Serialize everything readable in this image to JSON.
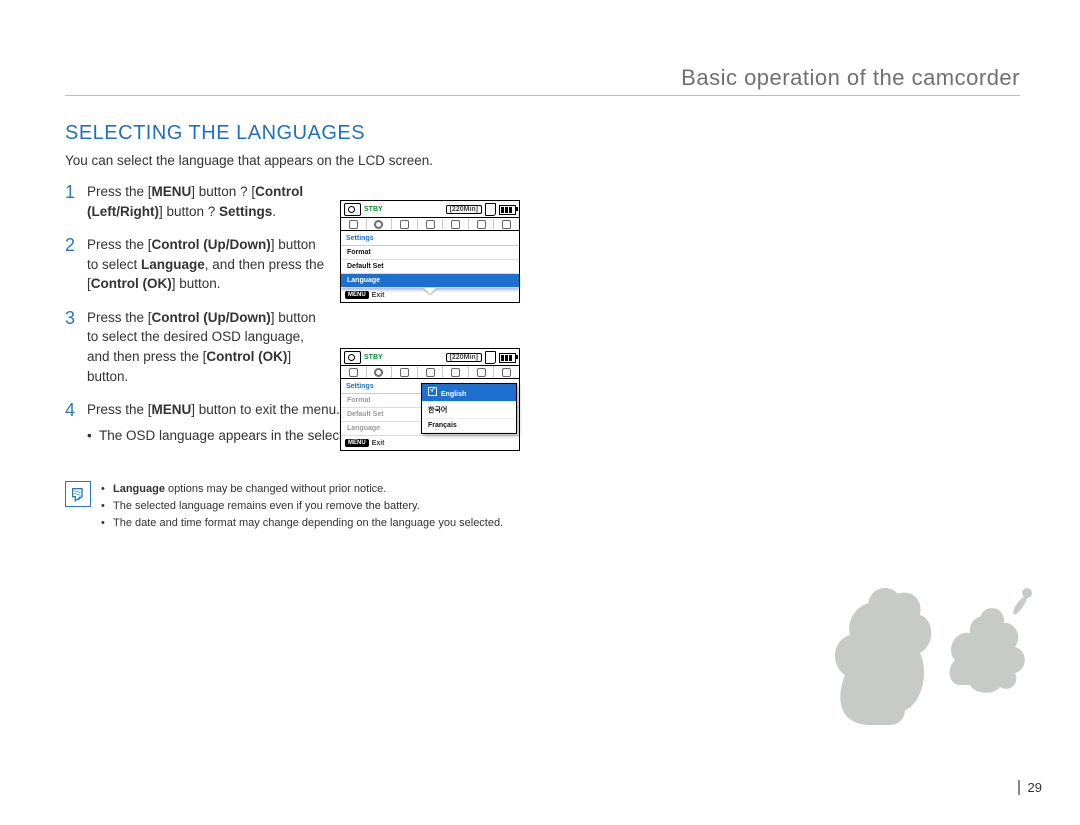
{
  "header": {
    "section": "Basic operation of the camcorder"
  },
  "title": "SELECTING THE LANGUAGES",
  "intro": "You can select the language that appears on the LCD screen.",
  "steps": [
    {
      "num": "1",
      "parts": [
        "Press the [",
        "MENU",
        "] button ? [",
        "Control (Left/Right)",
        "] button ? ",
        "Settings",
        "."
      ]
    },
    {
      "num": "2",
      "parts": [
        "Press the [",
        "Control (Up/Down)",
        "] button to select ",
        "Language",
        ", and then press the [",
        "Control (OK)",
        "] button."
      ]
    },
    {
      "num": "3",
      "parts": [
        "Press the [",
        "Control (Up/Down)",
        "] button to select the desired OSD language, and then press the [",
        "Control (OK)",
        "] button."
      ]
    },
    {
      "num": "4",
      "parts": [
        "Press the [",
        "MENU",
        "] button to exit the menu."
      ],
      "sub": [
        "The OSD language appears in the selected language."
      ]
    }
  ],
  "lcd": {
    "status": "STBY",
    "duration": "[220Min]",
    "tab_label": "Settings",
    "menu_chip": "MENU",
    "exit_label": "Exit",
    "screen1_items": [
      {
        "label": "Format",
        "state": "normal"
      },
      {
        "label": "Default Set",
        "state": "normal"
      },
      {
        "label": "Language",
        "state": "selected"
      }
    ],
    "screen2_items": [
      {
        "label": "Format",
        "state": "dim"
      },
      {
        "label": "Default Set",
        "state": "dim"
      },
      {
        "label": "Language",
        "state": "dim"
      }
    ],
    "language_options": [
      {
        "label": "English",
        "selected": true
      },
      {
        "label": "한국어",
        "selected": false
      },
      {
        "label": "Français",
        "selected": false
      }
    ]
  },
  "notes": [
    {
      "text": "Language options may be changed without prior notice.",
      "bold_prefix": "Language"
    },
    {
      "text": "The selected language remains even if you remove the battery."
    },
    {
      "text": "The date and time format may change depending on the language you selected."
    }
  ],
  "page_number": "29"
}
